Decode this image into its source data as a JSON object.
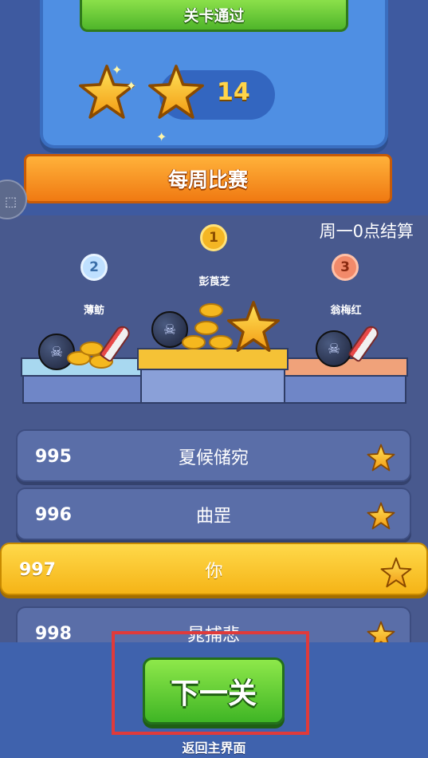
{
  "level_result": {
    "title": "关卡通过",
    "stars_earned": 2,
    "score": "14"
  },
  "weekly": {
    "title": "每周比赛",
    "settle_note": "周一0点结算"
  },
  "podium": [
    {
      "rank": "1",
      "name": "彭莨芝"
    },
    {
      "rank": "2",
      "name": "薄鲂"
    },
    {
      "rank": "3",
      "name": "翁梅红"
    }
  ],
  "ranking": [
    {
      "rank": "995",
      "name": "夏候储宛"
    },
    {
      "rank": "996",
      "name": "曲罡"
    },
    {
      "rank": "997",
      "name": "你"
    },
    {
      "rank": "998",
      "name": "晁捕悲"
    }
  ],
  "actions": {
    "next_label": "下一关",
    "return_label": "返回主界面"
  },
  "colors": {
    "accent_green": "#4fb52a",
    "accent_orange": "#f07a12",
    "highlight_yellow": "#f5b417",
    "highlight_red": "#e03a3a"
  }
}
